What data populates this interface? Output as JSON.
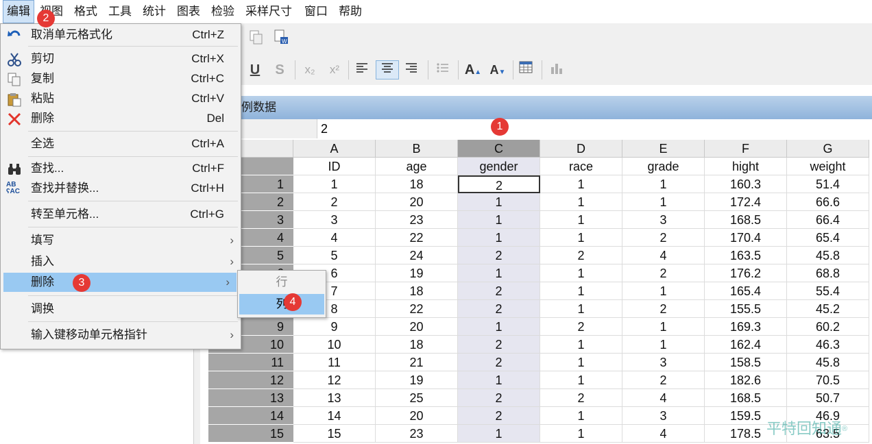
{
  "menubar": [
    "编辑",
    "视图",
    "格式",
    "工具",
    "统计",
    "图表",
    "检验",
    "采样尺寸",
    "窗口",
    "帮助"
  ],
  "data_window": {
    "title": "例数据",
    "cell_value": "2",
    "columns": [
      "A",
      "B",
      "C",
      "D",
      "E",
      "F",
      "G"
    ],
    "selected_column": "C",
    "var_names": [
      "ID",
      "age",
      "gender",
      "race",
      "grade",
      "hight",
      "weight"
    ],
    "rows": [
      [
        "1",
        "1",
        "18",
        "2",
        "1",
        "1",
        "160.3",
        "51.4"
      ],
      [
        "2",
        "2",
        "20",
        "1",
        "1",
        "1",
        "172.4",
        "66.6"
      ],
      [
        "3",
        "3",
        "23",
        "1",
        "1",
        "3",
        "168.5",
        "66.4"
      ],
      [
        "4",
        "4",
        "22",
        "1",
        "1",
        "2",
        "170.4",
        "65.4"
      ],
      [
        "5",
        "5",
        "24",
        "2",
        "2",
        "4",
        "163.5",
        "45.8"
      ],
      [
        "6",
        "6",
        "19",
        "1",
        "1",
        "2",
        "176.2",
        "68.8"
      ],
      [
        "7",
        "7",
        "18",
        "2",
        "1",
        "1",
        "165.4",
        "55.4"
      ],
      [
        "8",
        "8",
        "22",
        "2",
        "1",
        "2",
        "155.5",
        "45.2"
      ],
      [
        "9",
        "9",
        "20",
        "1",
        "2",
        "1",
        "169.3",
        "60.2"
      ],
      [
        "10",
        "10",
        "18",
        "2",
        "1",
        "1",
        "162.4",
        "46.3"
      ],
      [
        "11",
        "11",
        "21",
        "2",
        "1",
        "3",
        "158.5",
        "45.8"
      ],
      [
        "12",
        "12",
        "19",
        "1",
        "1",
        "2",
        "182.6",
        "70.5"
      ],
      [
        "13",
        "13",
        "25",
        "2",
        "2",
        "4",
        "168.5",
        "50.7"
      ],
      [
        "14",
        "14",
        "20",
        "2",
        "1",
        "3",
        "159.5",
        "46.9"
      ],
      [
        "15",
        "15",
        "23",
        "1",
        "1",
        "4",
        "178.5",
        "63.5"
      ]
    ]
  },
  "edit_menu": {
    "undo": {
      "label": "取消单元格式化",
      "shortcut": "Ctrl+Z",
      "icon": "undo-icon"
    },
    "cut": {
      "label": "剪切",
      "shortcut": "Ctrl+X",
      "icon": "scissors-icon"
    },
    "copy": {
      "label": "复制",
      "shortcut": "Ctrl+C",
      "icon": "copy-icon"
    },
    "paste": {
      "label": "粘贴",
      "shortcut": "Ctrl+V",
      "icon": "paste-icon"
    },
    "delete": {
      "label": "删除",
      "shortcut": "Del",
      "icon": "red-x-icon"
    },
    "select_all": {
      "label": "全选",
      "shortcut": "Ctrl+A"
    },
    "find": {
      "label": "查找...",
      "shortcut": "Ctrl+F",
      "icon": "binoculars-icon"
    },
    "replace": {
      "label": "查找并替换...",
      "shortcut": "Ctrl+H",
      "icon": "replace-abc-icon"
    },
    "goto": {
      "label": "转至单元格...",
      "shortcut": "Ctrl+G"
    },
    "fill": {
      "label": "填写"
    },
    "insert": {
      "label": "插入"
    },
    "remove": {
      "label": "删除"
    },
    "swap": {
      "label": "调换"
    },
    "enter_move": {
      "label": "输入键移动单元格指针"
    }
  },
  "submenu": {
    "row": "行",
    "column": "列"
  },
  "badges": [
    "1",
    "2",
    "3",
    "4"
  ],
  "watermark": "平特回知通",
  "colors": {
    "accent": "#99c9f2",
    "badge": "#e53935",
    "column_selected": "#e6e6f0",
    "row_header": "#a6a6a6"
  }
}
